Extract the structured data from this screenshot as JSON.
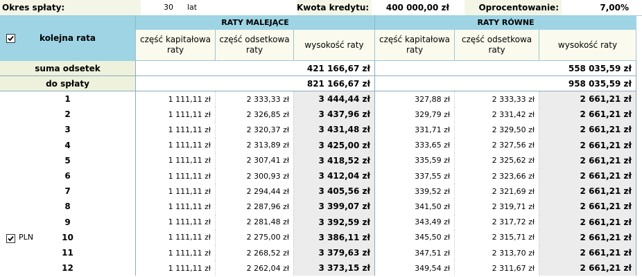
{
  "params": {
    "period_label": "Okres spłaty:",
    "period_value": "30",
    "period_unit": "lat",
    "amount_label": "Kwota kredytu:",
    "amount_value": "400 000,00 zł",
    "rate_label": "Oprocentowanie:",
    "rate_value": "7,00%"
  },
  "header": {
    "installment_label": "kolejna rata",
    "decreasing_title": "RATY MALEJĄCE",
    "equal_title": "RATY RÓWNE",
    "columns": [
      "część kapitałowa raty",
      "część odsetkowa raty",
      "wysokość raty"
    ]
  },
  "summary": {
    "interest_label": "suma odsetek",
    "interest_decreasing": "421 166,67 zł",
    "interest_equal": "558 035,59 zł",
    "total_label": "do spłaty",
    "total_decreasing": "821 166,67 zł",
    "total_equal": "958 035,59 zł"
  },
  "currency_checkbox_label": "PLN",
  "rows": [
    [
      "1",
      "1 111,11 zł",
      "2 333,33 zł",
      "3 444,44 zł",
      "327,88 zł",
      "2 333,33 zł",
      "2 661,21 zł"
    ],
    [
      "2",
      "1 111,11 zł",
      "2 326,85 zł",
      "3 437,96 zł",
      "329,79 zł",
      "2 331,42 zł",
      "2 661,21 zł"
    ],
    [
      "3",
      "1 111,11 zł",
      "2 320,37 zł",
      "3 431,48 zł",
      "331,71 zł",
      "2 329,50 zł",
      "2 661,21 zł"
    ],
    [
      "4",
      "1 111,11 zł",
      "2 313,89 zł",
      "3 425,00 zł",
      "333,65 zł",
      "2 327,56 zł",
      "2 661,21 zł"
    ],
    [
      "5",
      "1 111,11 zł",
      "2 307,41 zł",
      "3 418,52 zł",
      "335,59 zł",
      "2 325,62 zł",
      "2 661,21 zł"
    ],
    [
      "6",
      "1 111,11 zł",
      "2 300,93 zł",
      "3 412,04 zł",
      "337,55 zł",
      "2 323,66 zł",
      "2 661,21 zł"
    ],
    [
      "7",
      "1 111,11 zł",
      "2 294,44 zł",
      "3 405,56 zł",
      "339,52 zł",
      "2 321,69 zł",
      "2 661,21 zł"
    ],
    [
      "8",
      "1 111,11 zł",
      "2 287,96 zł",
      "3 399,07 zł",
      "341,50 zł",
      "2 319,71 zł",
      "2 661,21 zł"
    ],
    [
      "9",
      "1 111,11 zł",
      "2 281,48 zł",
      "3 392,59 zł",
      "343,49 zł",
      "2 317,72 zł",
      "2 661,21 zł"
    ],
    [
      "10",
      "1 111,11 zł",
      "2 275,00 zł",
      "3 386,11 zł",
      "345,50 zł",
      "2 315,71 zł",
      "2 661,21 zł"
    ],
    [
      "11",
      "1 111,11 zł",
      "2 268,52 zł",
      "3 379,63 zł",
      "347,51 zł",
      "2 313,70 zł",
      "2 661,21 zł"
    ],
    [
      "12",
      "1 111,11 zł",
      "2 262,04 zł",
      "3 373,15 zł",
      "349,54 zł",
      "2 311,67 zł",
      "2 661,21 zł"
    ]
  ],
  "colors": {
    "header_blue": "#9ed4e4",
    "subheader_bg": "#fafbee",
    "summary_label_bg": "#eef1dc",
    "installment_bg": "#ececec"
  }
}
